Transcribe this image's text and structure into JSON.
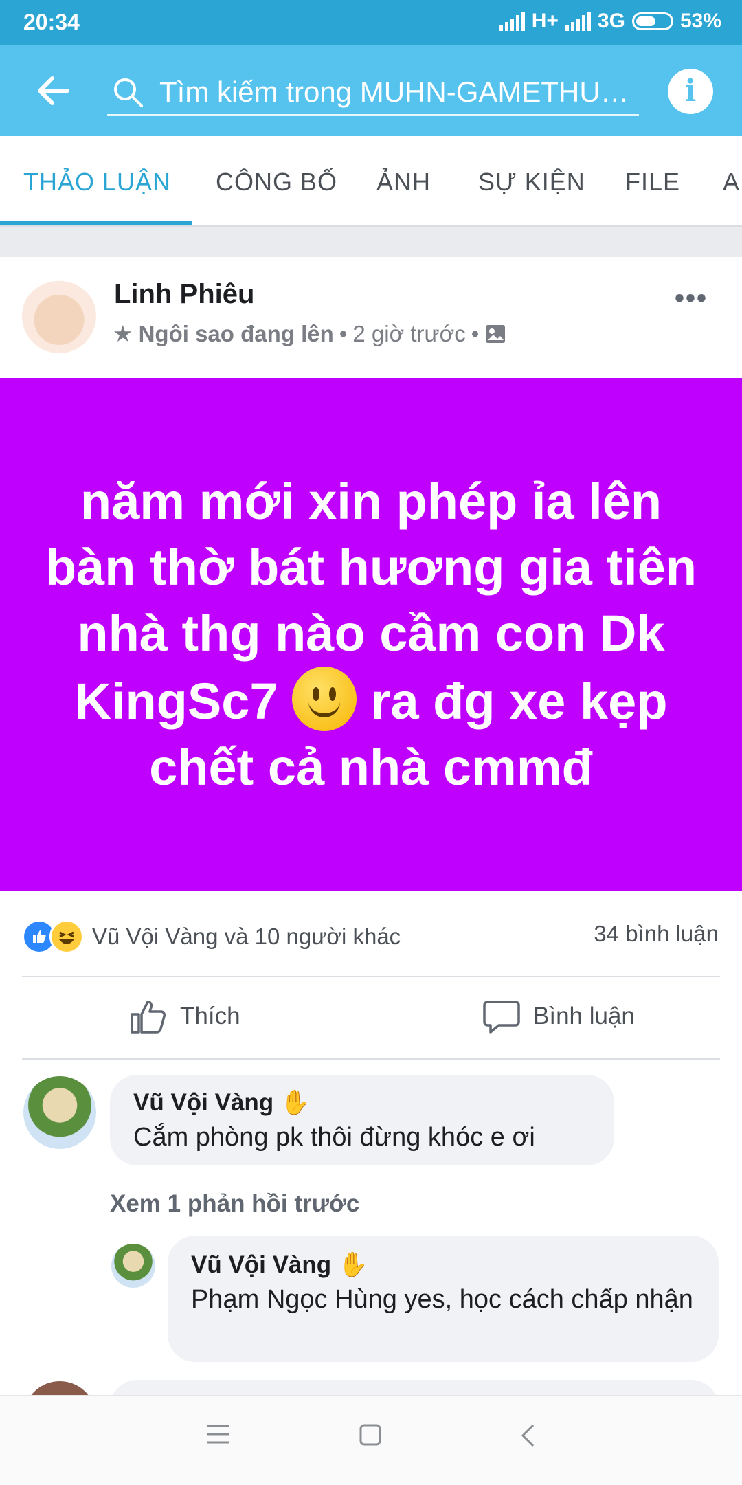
{
  "status": {
    "time": "20:34",
    "network1": "H+",
    "network2": "3G",
    "battery": "53%"
  },
  "appbar": {
    "search_placeholder": "Tìm kiếm trong MUHN-GAMETHU…",
    "info_icon": "i"
  },
  "tabs": [
    {
      "label": "THẢO LUẬN",
      "active": true
    },
    {
      "label": "CÔNG BỐ"
    },
    {
      "label": "ẢNH"
    },
    {
      "label": "SỰ KIỆN"
    },
    {
      "label": "FILE"
    },
    {
      "label": "A"
    }
  ],
  "post": {
    "author": "Linh Phiêu",
    "badge": "Ngôi sao đang lên",
    "time": "2 giờ trước",
    "text_before_emoji": "năm mới xin phép ỉa lên bàn thờ bát hương gia tiên nhà thg nào cầm con Dk KingSc7",
    "text_after_emoji": "ra đg xe kẹp chết cả nhà cmmđ",
    "background_color": "#c000ff",
    "reactions_text": "Vũ Vội Vàng và 10 người khác",
    "comment_count": "34 bình luận",
    "like_label": "Thích",
    "comment_label": "Bình luận"
  },
  "comments": [
    {
      "name": "Vũ Vội Vàng",
      "text": "Cắm phòng pk thôi đừng khóc e ơi"
    }
  ],
  "more_replies": "Xem 1 phản hồi trước",
  "replies": [
    {
      "name": "Vũ Vội Vàng",
      "text": "Phạm Ngọc Hùng yes, học cách chấp nhận"
    }
  ]
}
